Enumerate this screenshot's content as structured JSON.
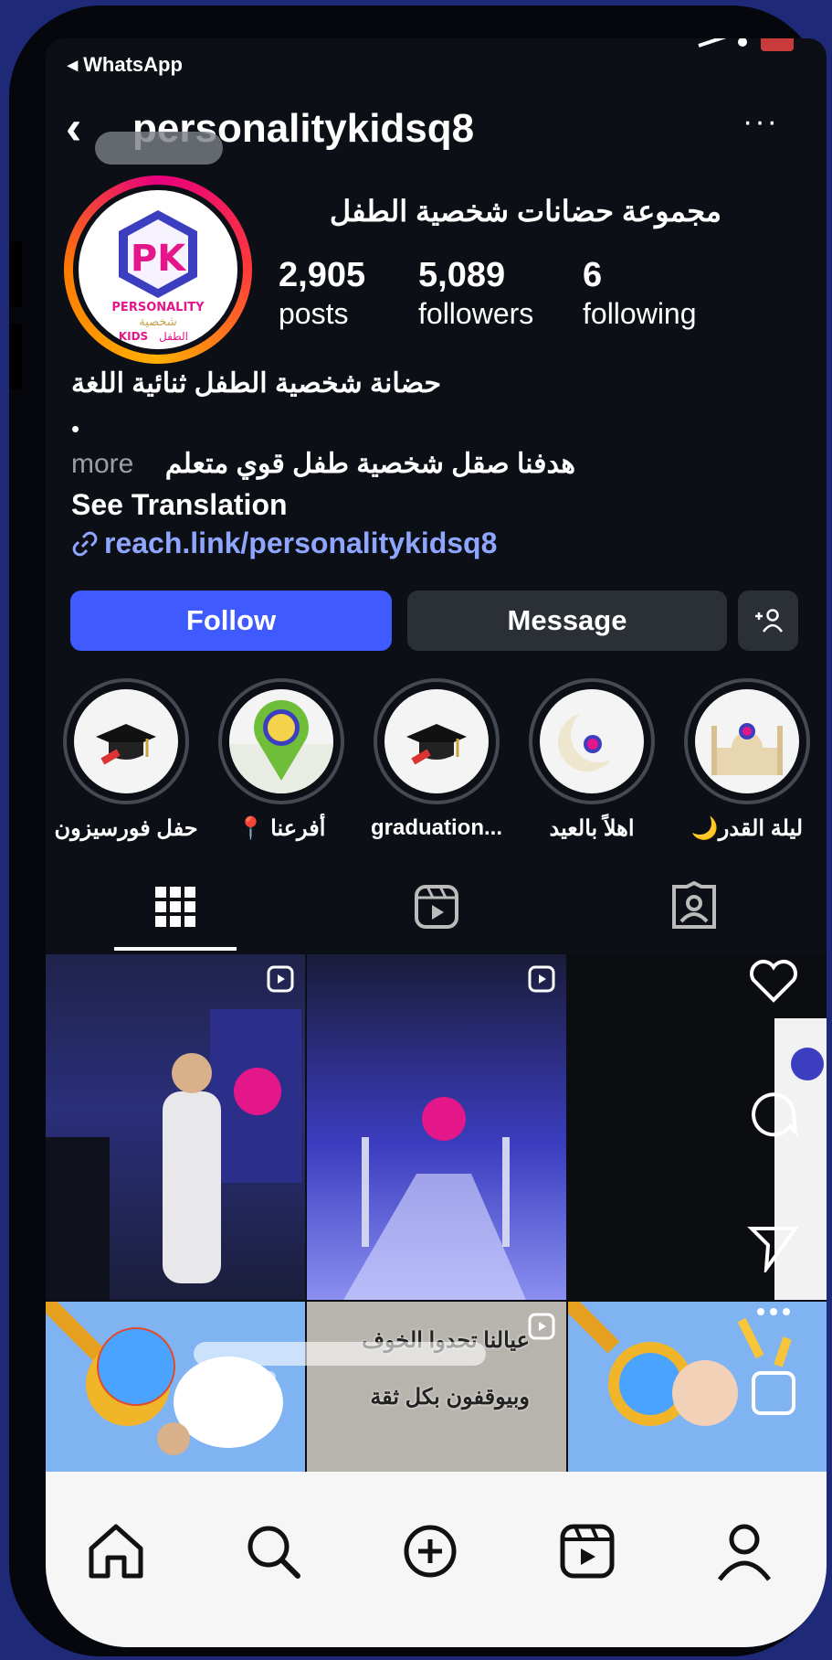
{
  "status": {
    "back_app": "◂ WhatsApp"
  },
  "header": {
    "username": "personalitykidsq8",
    "back_glyph": "‹",
    "more_glyph": "···"
  },
  "profile": {
    "full_name": "مجموعة حضانات شخصية الطفل",
    "avatar_text": {
      "pk": "PK",
      "line1": "PERSONALITY",
      "line2": "شخصية",
      "line3": "الطفل",
      "line4": "KIDS"
    }
  },
  "stats": [
    {
      "value": "2,905",
      "label": "posts"
    },
    {
      "value": "5,089",
      "label": "followers"
    },
    {
      "value": "6",
      "label": "following"
    }
  ],
  "bio": {
    "line1": "حضانة شخصية الطفل ثنائية اللغة",
    "dot": "•",
    "line2": "هدفنا صقل شخصية طفل قوي متعلم",
    "more": "more",
    "see_translation": "See Translation",
    "link": "reach.link/personalitykidsq8"
  },
  "actions": {
    "follow": "Follow",
    "message": "Message"
  },
  "highlights": [
    {
      "label": "حفل فورسيزون",
      "icon": "graduation-cap-icon"
    },
    {
      "label": "أفرعنا 📍",
      "icon": "location-pin-icon"
    },
    {
      "label": "graduation...",
      "icon": "graduation-cap-icon"
    },
    {
      "label": "اهلاً بالعيد",
      "icon": "crescent-icon"
    },
    {
      "label": "ليلة القدر🌙",
      "icon": "mosque-icon"
    }
  ],
  "tabs": [
    "grid-icon",
    "reels-icon",
    "tagged-icon"
  ],
  "posts": {
    "captions": {
      "line1": "عيالنا تحدوا الخوف",
      "line2": "وبيوقفون بكل ثقة"
    }
  },
  "bottom_nav": [
    "home-icon",
    "search-icon",
    "create-icon",
    "reels-icon",
    "profile-icon"
  ],
  "colors": {
    "follow": "#3f5bff",
    "link": "#8fa6ff",
    "background": "#1e2a78"
  }
}
